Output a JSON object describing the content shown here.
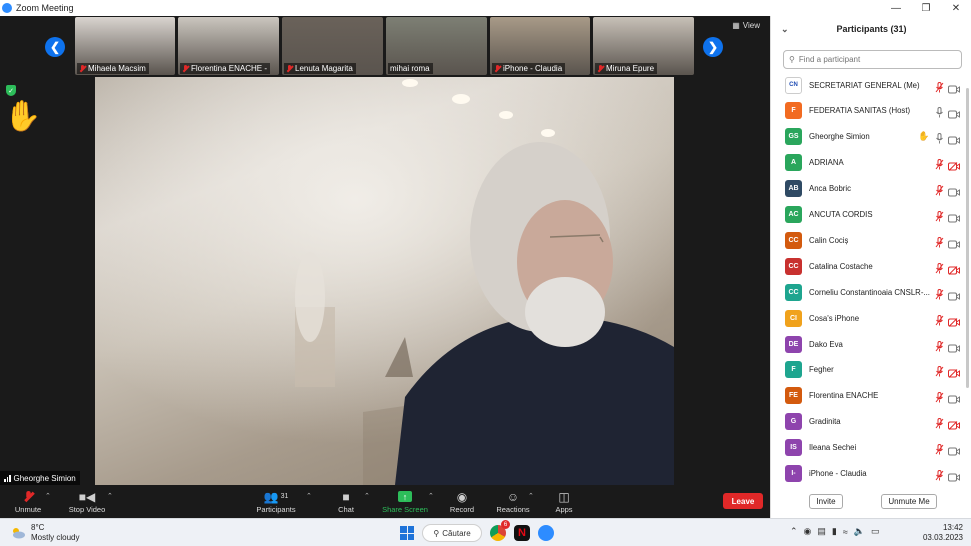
{
  "window": {
    "title": "Zoom Meeting",
    "controls": [
      "minimize",
      "restore",
      "close"
    ]
  },
  "gallery": {
    "view_label": "View",
    "thumbnails": [
      {
        "name": "Mihaela Macsim",
        "muted": true,
        "bg": "#d9d4cf"
      },
      {
        "name": "Florentina  ENACHE -",
        "muted": true,
        "bg": "#cbc6bf"
      },
      {
        "name": "Lenuta Magarita",
        "muted": true,
        "bg": "#6a625a"
      },
      {
        "name": "mihai roma",
        "muted": false,
        "bg": "#7d7f74"
      },
      {
        "name": "iPhone - Claudia",
        "muted": true,
        "bg": "#a89a88"
      },
      {
        "name": "Miruna Epure",
        "muted": true,
        "bg": "#c7c0b7"
      }
    ]
  },
  "main_video": {
    "speaker": "Gheorghe Simion"
  },
  "toolbar": {
    "unmute": "Unmute",
    "stop_video": "Stop Video",
    "participants": "Participants",
    "participants_count": "31",
    "chat": "Chat",
    "share_screen": "Share Screen",
    "record": "Record",
    "reactions": "Reactions",
    "apps": "Apps",
    "leave": "Leave"
  },
  "panel": {
    "title": "Participants (31)",
    "search_placeholder": "Find a participant",
    "invite": "Invite",
    "unmute_me": "Unmute Me",
    "participants": [
      {
        "initials": "CN",
        "name": "SECRETARIAT GENERAL (Me)",
        "color": "#ffffff",
        "mic": "muted",
        "cam": "on",
        "hand": false
      },
      {
        "initials": "F",
        "name": "FEDERATIA SANITAS (Host)",
        "color": "#f26b21",
        "mic": "on",
        "cam": "on",
        "hand": false
      },
      {
        "initials": "GS",
        "name": "Gheorghe Simion",
        "color": "#2aa65c",
        "mic": "on",
        "cam": "on",
        "hand": true
      },
      {
        "initials": "A",
        "name": "ADRIANA",
        "color": "#2aa65c",
        "mic": "muted",
        "cam": "off",
        "hand": false
      },
      {
        "initials": "AB",
        "name": "Anca Bobric",
        "color": "#2f4a64",
        "mic": "muted",
        "cam": "on",
        "hand": false
      },
      {
        "initials": "AC",
        "name": "ANCUTA CORDIS",
        "color": "#2aa65c",
        "mic": "muted",
        "cam": "on",
        "hand": false
      },
      {
        "initials": "CC",
        "name": "Calin Cociș",
        "color": "#d35a0e",
        "mic": "muted",
        "cam": "on",
        "hand": false
      },
      {
        "initials": "CC",
        "name": "Catalina Costache",
        "color": "#c8312f",
        "mic": "muted",
        "cam": "off",
        "hand": false
      },
      {
        "initials": "CC",
        "name": "Corneliu Constantinoaia CNSLR-...",
        "color": "#1ea58f",
        "mic": "muted",
        "cam": "on",
        "hand": false
      },
      {
        "initials": "CI",
        "name": "Cosa's iPhone",
        "color": "#f0a21c",
        "mic": "muted",
        "cam": "off",
        "hand": false
      },
      {
        "initials": "DE",
        "name": "Dako Eva",
        "color": "#8e44ad",
        "mic": "muted",
        "cam": "on",
        "hand": false
      },
      {
        "initials": "F",
        "name": "Fegher",
        "color": "#1ea58f",
        "mic": "muted",
        "cam": "off",
        "hand": false
      },
      {
        "initials": "FE",
        "name": "Florentina  ENACHE",
        "color": "#d35a0e",
        "mic": "muted",
        "cam": "on",
        "hand": false
      },
      {
        "initials": "G",
        "name": "Gradinita",
        "color": "#8e44ad",
        "mic": "muted",
        "cam": "off",
        "hand": false
      },
      {
        "initials": "IS",
        "name": "Ileana Sechei",
        "color": "#8e44ad",
        "mic": "muted",
        "cam": "on",
        "hand": false
      },
      {
        "initials": "I-",
        "name": "iPhone - Claudia",
        "color": "#8e44ad",
        "mic": "muted",
        "cam": "on",
        "hand": false
      }
    ]
  },
  "taskbar": {
    "temperature": "8°C",
    "weather": "Mostly cloudy",
    "search": "Căutare",
    "chrome_badge": "6",
    "time": "13:42",
    "date": "03.03.2023"
  }
}
